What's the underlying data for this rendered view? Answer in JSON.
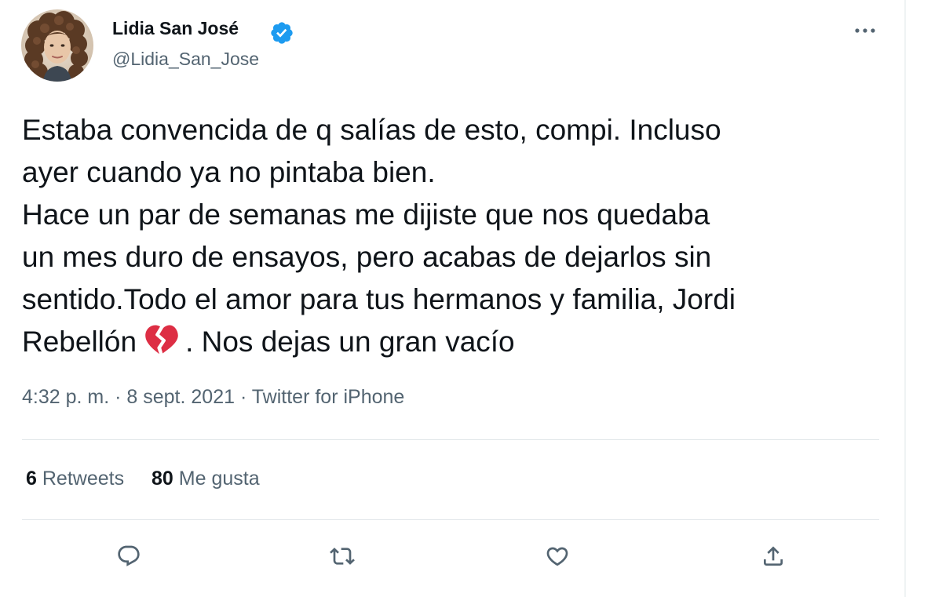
{
  "author": {
    "name": "Lidia San José",
    "handle": "@Lidia_San_Jose",
    "verified": true,
    "avatar_icon": "profile-photo"
  },
  "tweet": {
    "lines": [
      "Estaba convencida de q salías de esto, compi. Incluso",
      "ayer cuando ya no pintaba bien.",
      "Hace un par de semanas me dijiste que nos quedaba",
      "un mes duro de ensayos, pero acabas de dejarlos sin",
      "sentido.Todo el amor para tus hermanos y familia, Jordi"
    ],
    "last_line_before_emoji": "Rebellón",
    "emoji": "broken-heart",
    "last_line_after_emoji": ". Nos dejas un gran vacío"
  },
  "meta": {
    "time": "4:32 p. m.",
    "separator": " · ",
    "date": "8 sept. 2021",
    "source": "Twitter for iPhone"
  },
  "stats": {
    "retweets_count": "6",
    "retweets_label": "Retweets",
    "likes_count": "80",
    "likes_label": "Me gusta"
  },
  "actions": [
    "reply-icon",
    "retweet-icon",
    "like-icon",
    "share-icon"
  ],
  "colors": {
    "text": "#0f1419",
    "secondary": "#536471",
    "verified": "#1d9bf0",
    "broken_heart": "#dd2e44",
    "divider": "#e1e6e9"
  }
}
